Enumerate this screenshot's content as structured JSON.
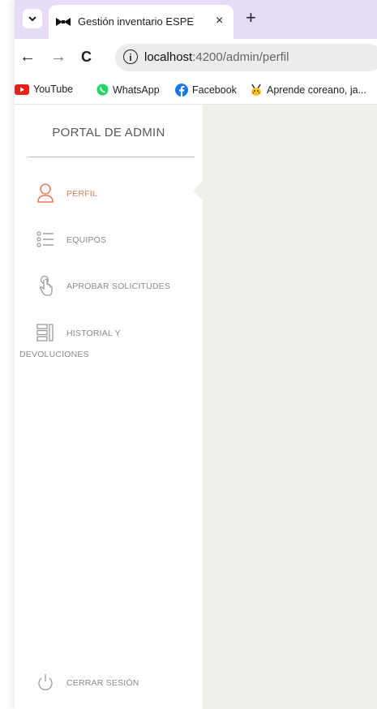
{
  "browser": {
    "tab_title": "Gestión inventario ESPE",
    "tab_close": "×",
    "new_tab": "+",
    "nav": {
      "back": "←",
      "forward": "→",
      "reload": "C"
    },
    "url_host": "localhost",
    "url_rest": ":4200/admin/perfil",
    "info_icon": "i",
    "bookmarks": [
      {
        "label": "YouTube",
        "icon": "youtube-icon"
      },
      {
        "label": "WhatsApp",
        "icon": "whatsapp-icon"
      },
      {
        "label": "Facebook",
        "icon": "facebook-icon"
      },
      {
        "label": "Aprende coreano, ja...",
        "icon": "pikachu-icon"
      }
    ]
  },
  "sidebar": {
    "title": "PORTAL DE ADMIN",
    "items": [
      {
        "label": "PERFIL",
        "icon": "user-icon",
        "active": true
      },
      {
        "label": "EQUIPOS",
        "icon": "list-icon"
      },
      {
        "label": "APROBAR SOLICITUDES",
        "icon": "touch-icon"
      },
      {
        "label": "HISTORIAL Y",
        "label_2": "DEVOLUCIONES",
        "icon": "history-icon"
      }
    ],
    "logout": {
      "label": "CERRAR SESIÓN",
      "icon": "power-icon"
    }
  },
  "colors": {
    "accent": "#e57c5f",
    "tabstrip": "#e6dcf5",
    "main_bg": "#f1efec"
  }
}
